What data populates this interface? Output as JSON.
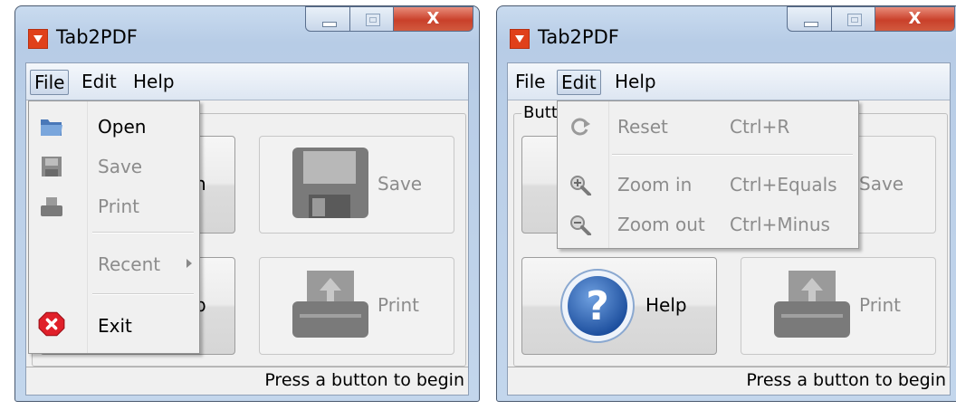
{
  "colors": {
    "accent": "#e0401a",
    "menu_highlight": "#cbd8ea",
    "disabled_text": "#8c8c8c"
  },
  "windows": [
    {
      "title": "Tab2PDF",
      "close_glyph": "X",
      "menubar": {
        "file": "File",
        "edit": "Edit",
        "help": "Help",
        "active": "File"
      },
      "buttons": {
        "partial_top_label": "n",
        "partial_bottom_label": "p",
        "save": "Save",
        "print": "Print"
      },
      "status": "Press a button to begin",
      "file_menu": [
        {
          "label": "Open",
          "icon": "folder-icon",
          "enabled": true
        },
        {
          "label": "Save",
          "icon": "floppy-icon",
          "enabled": false
        },
        {
          "label": "Print",
          "icon": "printer-icon",
          "enabled": false
        },
        {
          "label": "Recent",
          "enabled": false,
          "submenu": true
        },
        {
          "label": "Exit",
          "icon": "exit-icon",
          "enabled": true
        }
      ]
    },
    {
      "title": "Tab2PDF",
      "close_glyph": "X",
      "menubar": {
        "file": "File",
        "edit": "Edit",
        "help": "Help",
        "active": "Edit"
      },
      "group_label": "Butt",
      "buttons": {
        "save": "Save",
        "help": "Help",
        "print": "Print"
      },
      "status": "Press a button to begin",
      "edit_menu": [
        {
          "label": "Reset",
          "shortcut": "Ctrl+R",
          "icon": "refresh-icon",
          "enabled": false
        },
        {
          "label": "Zoom in",
          "shortcut": "Ctrl+Equals",
          "icon": "zoom-in-icon",
          "enabled": false
        },
        {
          "label": "Zoom out",
          "shortcut": "Ctrl+Minus",
          "icon": "zoom-out-icon",
          "enabled": false
        }
      ]
    }
  ]
}
